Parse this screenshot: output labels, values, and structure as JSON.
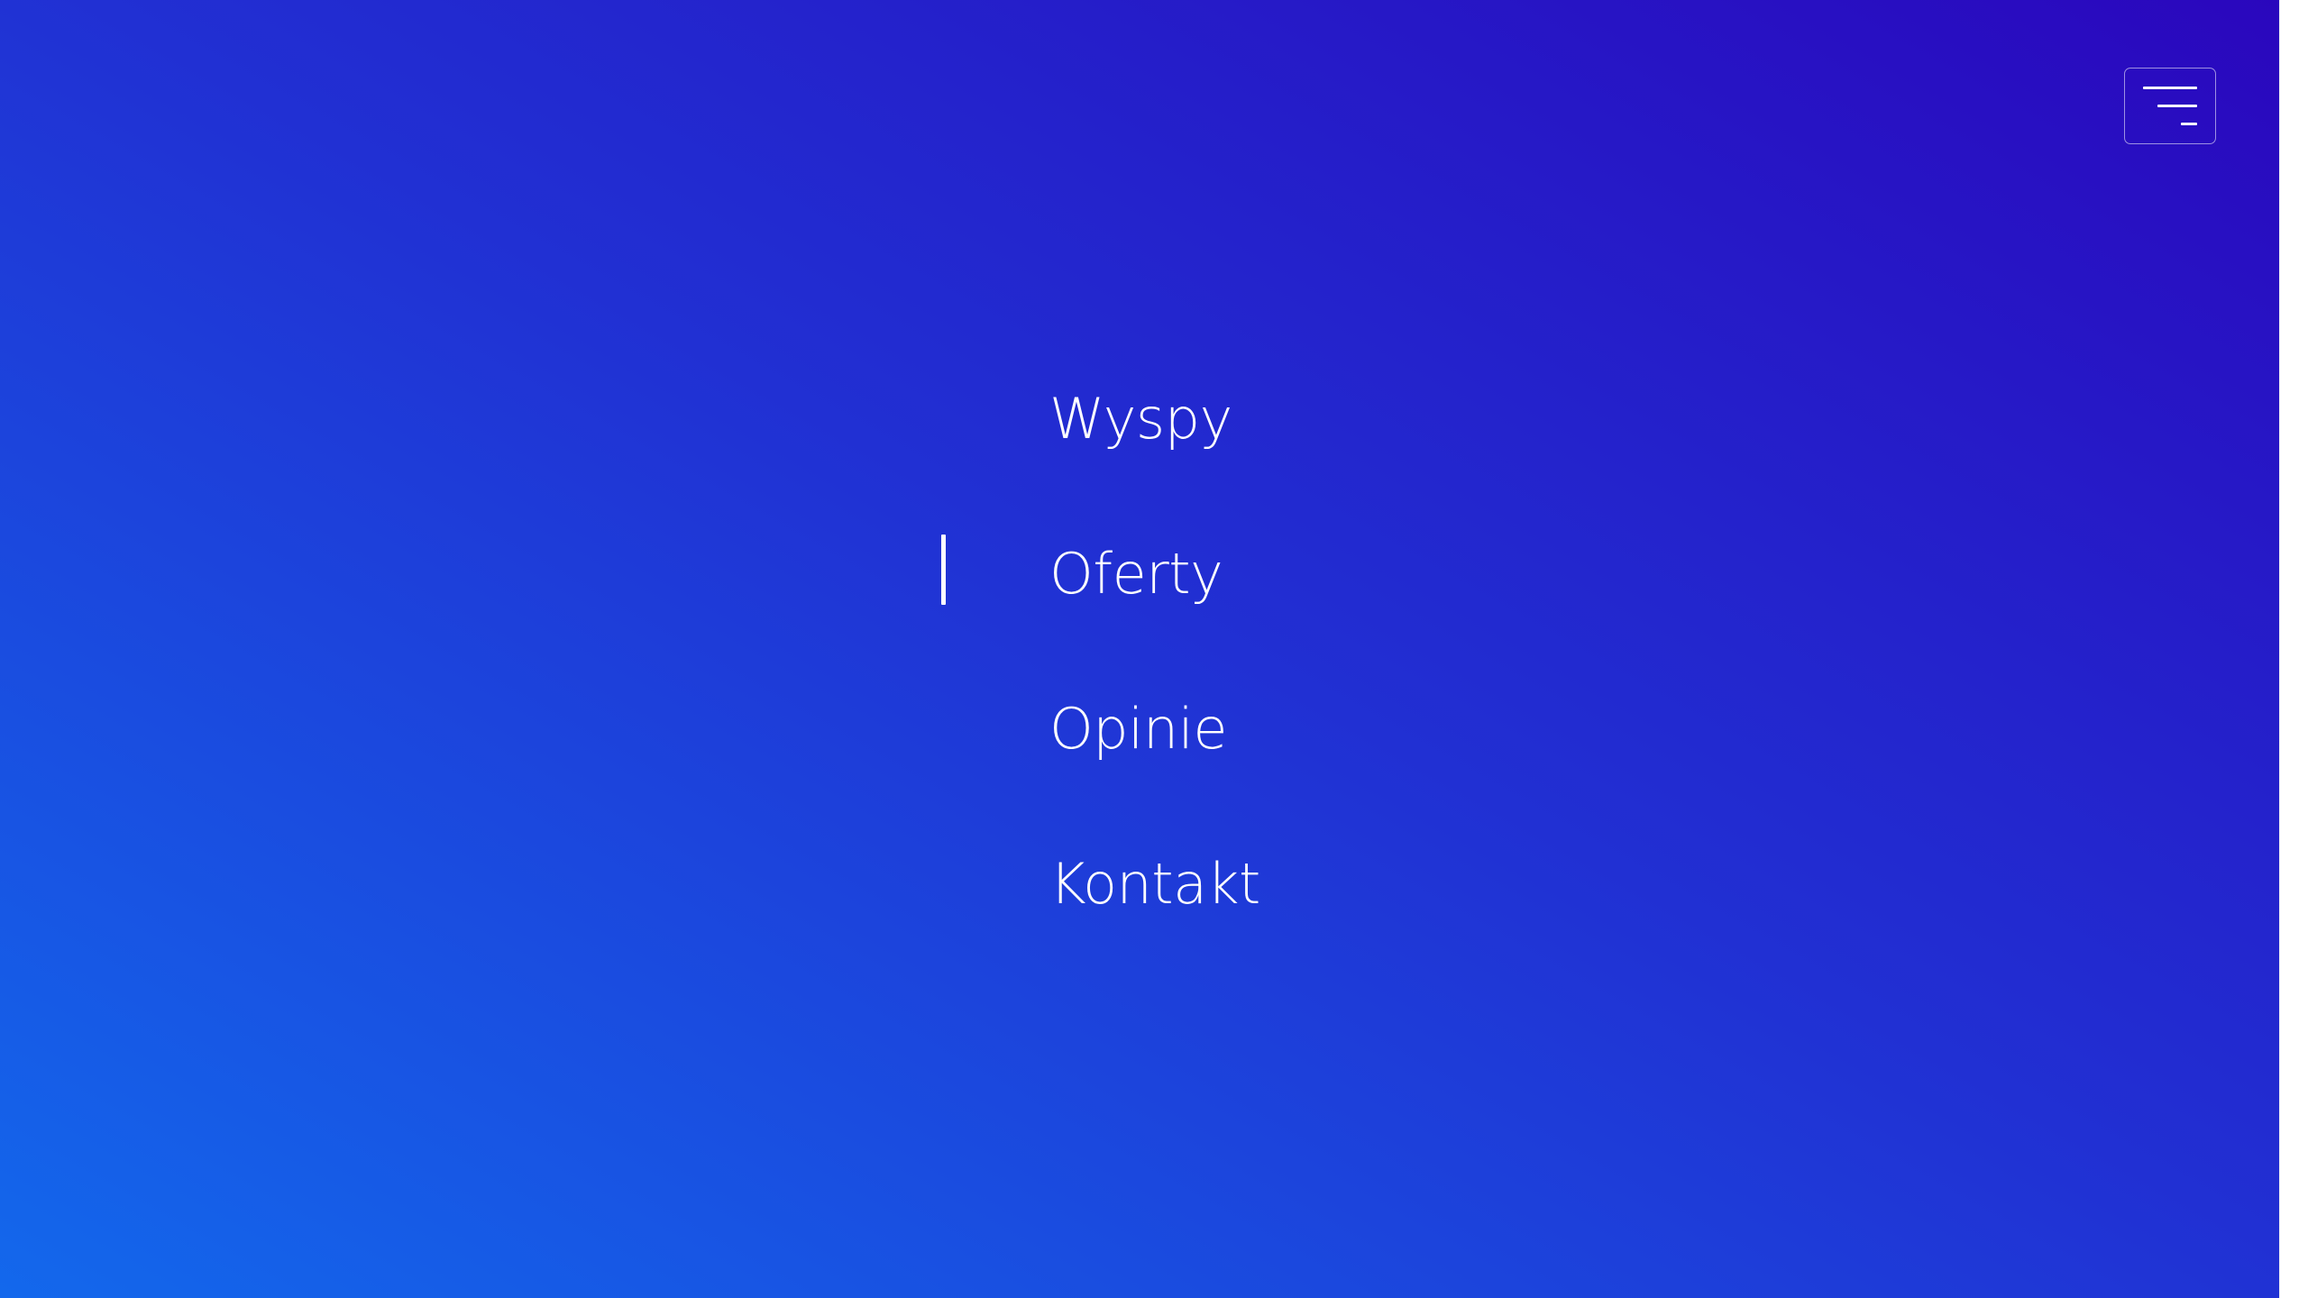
{
  "header": {
    "menu_toggle_icon": "menu-lines-icon"
  },
  "nav": {
    "active_index": 1,
    "items": [
      {
        "label": "Wyspy"
      },
      {
        "label": "Oferty"
      },
      {
        "label": "Opinie"
      },
      {
        "label": "Kontakt"
      }
    ]
  },
  "colors": {
    "gradient_start": "#1368ec",
    "gradient_mid": "#2130d3",
    "gradient_end": "#2a07bd",
    "text": "#ffffff"
  }
}
